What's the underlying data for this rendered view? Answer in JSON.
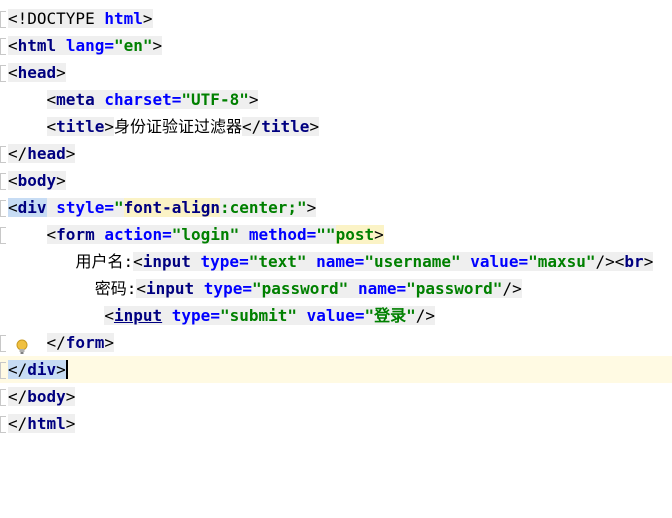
{
  "editor": {
    "line1": {
      "open": "<!",
      "doctype": "DOCTYPE",
      "html": "html",
      "close": ">"
    },
    "line2": {
      "open": "<",
      "tag": "html",
      "attr": "lang=",
      "val": "\"en\"",
      "close": ">"
    },
    "line3": {
      "open": "<",
      "tag": "head",
      "close": ">"
    },
    "line4": {
      "open": "<",
      "tag": "meta",
      "attr": "charset=",
      "val": "\"UTF-8\"",
      "close": ">"
    },
    "line5": {
      "open": "<",
      "tag": "title",
      "close": ">",
      "text": "身份证验证过滤器",
      "end_open": "</",
      "end_tag": "title",
      "end_close": ">"
    },
    "line6": {
      "open": "</",
      "tag": "head",
      "close": ">"
    },
    "line7": {
      "open": "<",
      "tag": "body",
      "close": ">"
    },
    "line8": {
      "open": "<",
      "tag": "div",
      "attr": "style=",
      "q1": "\"",
      "prop": "font-align",
      "rest": ":center;",
      "q2": "\"",
      "close": ">"
    },
    "line9": {
      "open": "<",
      "tag": "form",
      "attr1": "action=",
      "val1": "\"login\"",
      "attr2": "method=",
      "val2": "\"\"",
      "trail": "post",
      "close": ">"
    },
    "line10": {
      "label": "用户名:",
      "open": "<",
      "tag": "input",
      "attr1": "type=",
      "val1": "\"text\"",
      "attr2": "name=",
      "val2": "\"username\"",
      "attr3": "value=",
      "val3": "\"maxsu\"",
      "close": "/>",
      "br_open": "<",
      "br_tag": "br",
      "br_close": ">"
    },
    "line11": {
      "label": "密码:",
      "open": "<",
      "tag": "input",
      "attr1": "type=",
      "val1": "\"password\"",
      "attr2": "name=",
      "val2": "\"password\"",
      "close": "/>"
    },
    "line12": {
      "open": "<",
      "tag": "input",
      "attr1": "type=",
      "val1": "\"submit\"",
      "attr2": "value=",
      "val2": "\"登录\"",
      "close": "/>"
    },
    "line13": {
      "open": "</",
      "tag": "form",
      "close": ">"
    },
    "line14": {
      "open": "</",
      "tag": "div",
      "close": ">"
    },
    "line15": {
      "open": "</",
      "tag": "body",
      "close": ">"
    },
    "line16": {
      "open": "</",
      "tag": "html",
      "close": ">"
    }
  },
  "colors": {
    "tag": "#000080",
    "attribute": "#0000ff",
    "string": "#008000",
    "current_line": "#fffae3",
    "match_highlight": "#c7dcf4",
    "bulb": "#f0c040"
  },
  "icons": {
    "bulb": "lightbulb-icon"
  }
}
